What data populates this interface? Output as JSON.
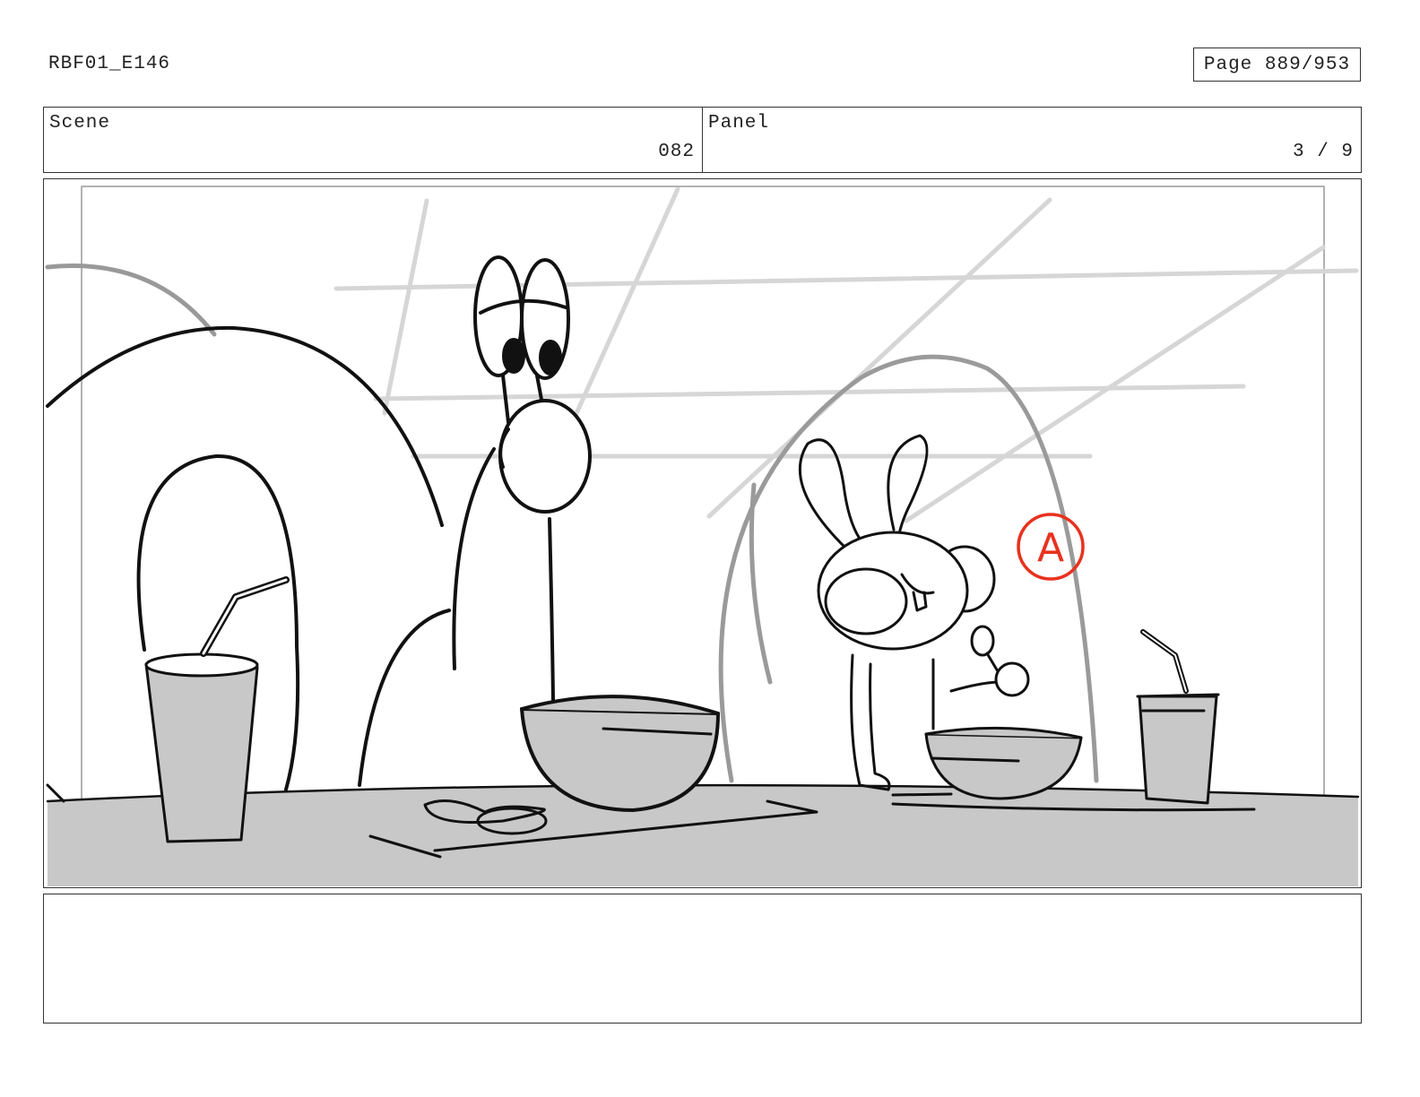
{
  "header": {
    "doc_id": "RBF01_E146",
    "page": "Page 889/953"
  },
  "info": {
    "scene_label": "Scene",
    "scene_value": "082",
    "panel_label": "Panel",
    "panel_value": "3 / 9"
  },
  "artwork": {
    "annotation_mark": "A",
    "annotation_color": "#e8321e"
  },
  "notes": {
    "text": ""
  }
}
